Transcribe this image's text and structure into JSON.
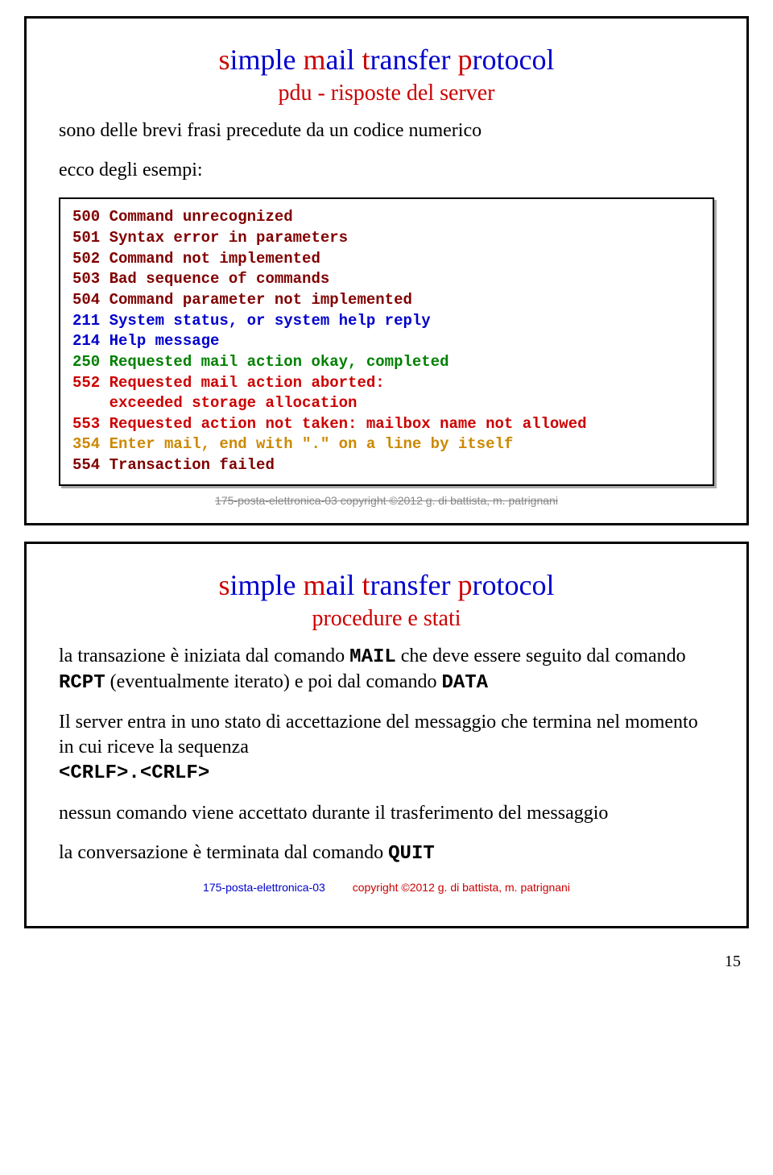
{
  "slide1": {
    "title_parts": [
      "s",
      "imple ",
      "m",
      "ail ",
      "t",
      "ransfer ",
      "p",
      "rotocol"
    ],
    "subtitle": "pdu - risposte del server",
    "intro1": "sono delle brevi frasi precedute da un codice numerico",
    "intro2": "ecco degli esempi:",
    "codes": {
      "l1": "500 Command unrecognized",
      "l2": "501 Syntax error in parameters",
      "l3": "502 Command not implemented",
      "l4": "503 Bad sequence of commands",
      "l5": "504 Command parameter not implemented",
      "l6": "211 System status, or system help reply",
      "l7": "214 Help message",
      "l8": "250 Requested mail action okay, completed",
      "l9": "552 Requested mail action aborted:",
      "l10": "    exceeded storage allocation",
      "l11": "553 Requested action not taken: mailbox name not allowed",
      "l12": "354 Enter mail, end with \".\" on a line by itself",
      "l13": "554 Transaction failed"
    },
    "footer_struck": "175-posta-elettronica-03      copyright ©2012 g. di battista, m. patrignani"
  },
  "slide2": {
    "title_parts": [
      "s",
      "imple ",
      "m",
      "ail ",
      "t",
      "ransfer ",
      "p",
      "rotocol"
    ],
    "subtitle": "procedure e stati",
    "p1a": "la transazione è iniziata dal comando ",
    "p1b": "MAIL",
    "p1c": " che deve essere seguito dal comando ",
    "p1d": "RCPT",
    "p1e": " (eventualmente iterato) e poi dal comando ",
    "p1f": "DATA",
    "p2a": "Il server entra in uno stato di accettazione del messaggio che termina nel momento in cui riceve la sequenza ",
    "p2b": "<CRLF>.<CRLF>",
    "p3": "nessun comando viene accettato durante il trasferimento del messaggio",
    "p4a": "la conversazione è terminata dal comando ",
    "p4b": "QUIT",
    "footer_left": "175-posta-elettronica-03",
    "footer_right": "copyright ©2012 g. di battista, m. patrignani"
  },
  "page_number": "15"
}
